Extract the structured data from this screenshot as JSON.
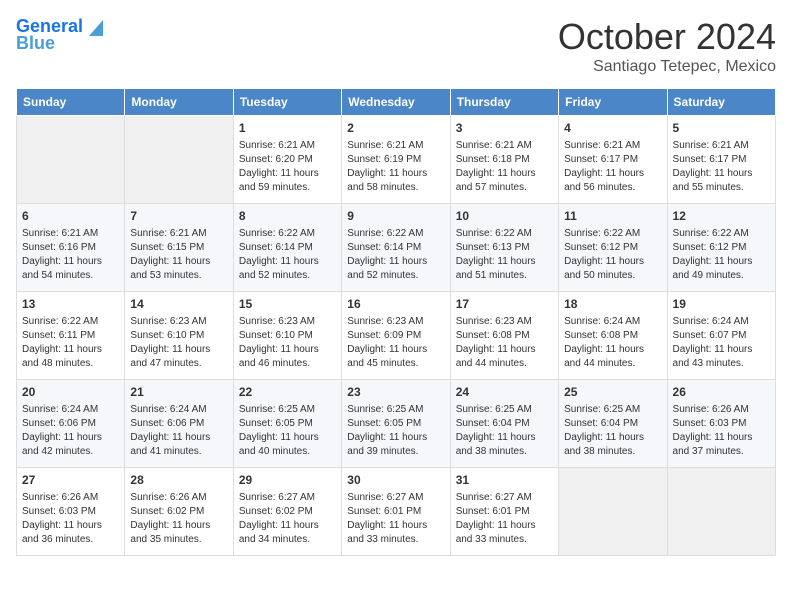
{
  "header": {
    "logo_line1": "General",
    "logo_line2": "Blue",
    "month": "October 2024",
    "location": "Santiago Tetepec, Mexico"
  },
  "weekdays": [
    "Sunday",
    "Monday",
    "Tuesday",
    "Wednesday",
    "Thursday",
    "Friday",
    "Saturday"
  ],
  "weeks": [
    [
      {
        "day": "",
        "sunrise": "",
        "sunset": "",
        "daylight": "",
        "empty": true
      },
      {
        "day": "",
        "sunrise": "",
        "sunset": "",
        "daylight": "",
        "empty": true
      },
      {
        "day": "1",
        "sunrise": "Sunrise: 6:21 AM",
        "sunset": "Sunset: 6:20 PM",
        "daylight": "Daylight: 11 hours and 59 minutes."
      },
      {
        "day": "2",
        "sunrise": "Sunrise: 6:21 AM",
        "sunset": "Sunset: 6:19 PM",
        "daylight": "Daylight: 11 hours and 58 minutes."
      },
      {
        "day": "3",
        "sunrise": "Sunrise: 6:21 AM",
        "sunset": "Sunset: 6:18 PM",
        "daylight": "Daylight: 11 hours and 57 minutes."
      },
      {
        "day": "4",
        "sunrise": "Sunrise: 6:21 AM",
        "sunset": "Sunset: 6:17 PM",
        "daylight": "Daylight: 11 hours and 56 minutes."
      },
      {
        "day": "5",
        "sunrise": "Sunrise: 6:21 AM",
        "sunset": "Sunset: 6:17 PM",
        "daylight": "Daylight: 11 hours and 55 minutes."
      }
    ],
    [
      {
        "day": "6",
        "sunrise": "Sunrise: 6:21 AM",
        "sunset": "Sunset: 6:16 PM",
        "daylight": "Daylight: 11 hours and 54 minutes."
      },
      {
        "day": "7",
        "sunrise": "Sunrise: 6:21 AM",
        "sunset": "Sunset: 6:15 PM",
        "daylight": "Daylight: 11 hours and 53 minutes."
      },
      {
        "day": "8",
        "sunrise": "Sunrise: 6:22 AM",
        "sunset": "Sunset: 6:14 PM",
        "daylight": "Daylight: 11 hours and 52 minutes."
      },
      {
        "day": "9",
        "sunrise": "Sunrise: 6:22 AM",
        "sunset": "Sunset: 6:14 PM",
        "daylight": "Daylight: 11 hours and 52 minutes."
      },
      {
        "day": "10",
        "sunrise": "Sunrise: 6:22 AM",
        "sunset": "Sunset: 6:13 PM",
        "daylight": "Daylight: 11 hours and 51 minutes."
      },
      {
        "day": "11",
        "sunrise": "Sunrise: 6:22 AM",
        "sunset": "Sunset: 6:12 PM",
        "daylight": "Daylight: 11 hours and 50 minutes."
      },
      {
        "day": "12",
        "sunrise": "Sunrise: 6:22 AM",
        "sunset": "Sunset: 6:12 PM",
        "daylight": "Daylight: 11 hours and 49 minutes."
      }
    ],
    [
      {
        "day": "13",
        "sunrise": "Sunrise: 6:22 AM",
        "sunset": "Sunset: 6:11 PM",
        "daylight": "Daylight: 11 hours and 48 minutes."
      },
      {
        "day": "14",
        "sunrise": "Sunrise: 6:23 AM",
        "sunset": "Sunset: 6:10 PM",
        "daylight": "Daylight: 11 hours and 47 minutes."
      },
      {
        "day": "15",
        "sunrise": "Sunrise: 6:23 AM",
        "sunset": "Sunset: 6:10 PM",
        "daylight": "Daylight: 11 hours and 46 minutes."
      },
      {
        "day": "16",
        "sunrise": "Sunrise: 6:23 AM",
        "sunset": "Sunset: 6:09 PM",
        "daylight": "Daylight: 11 hours and 45 minutes."
      },
      {
        "day": "17",
        "sunrise": "Sunrise: 6:23 AM",
        "sunset": "Sunset: 6:08 PM",
        "daylight": "Daylight: 11 hours and 44 minutes."
      },
      {
        "day": "18",
        "sunrise": "Sunrise: 6:24 AM",
        "sunset": "Sunset: 6:08 PM",
        "daylight": "Daylight: 11 hours and 44 minutes."
      },
      {
        "day": "19",
        "sunrise": "Sunrise: 6:24 AM",
        "sunset": "Sunset: 6:07 PM",
        "daylight": "Daylight: 11 hours and 43 minutes."
      }
    ],
    [
      {
        "day": "20",
        "sunrise": "Sunrise: 6:24 AM",
        "sunset": "Sunset: 6:06 PM",
        "daylight": "Daylight: 11 hours and 42 minutes."
      },
      {
        "day": "21",
        "sunrise": "Sunrise: 6:24 AM",
        "sunset": "Sunset: 6:06 PM",
        "daylight": "Daylight: 11 hours and 41 minutes."
      },
      {
        "day": "22",
        "sunrise": "Sunrise: 6:25 AM",
        "sunset": "Sunset: 6:05 PM",
        "daylight": "Daylight: 11 hours and 40 minutes."
      },
      {
        "day": "23",
        "sunrise": "Sunrise: 6:25 AM",
        "sunset": "Sunset: 6:05 PM",
        "daylight": "Daylight: 11 hours and 39 minutes."
      },
      {
        "day": "24",
        "sunrise": "Sunrise: 6:25 AM",
        "sunset": "Sunset: 6:04 PM",
        "daylight": "Daylight: 11 hours and 38 minutes."
      },
      {
        "day": "25",
        "sunrise": "Sunrise: 6:25 AM",
        "sunset": "Sunset: 6:04 PM",
        "daylight": "Daylight: 11 hours and 38 minutes."
      },
      {
        "day": "26",
        "sunrise": "Sunrise: 6:26 AM",
        "sunset": "Sunset: 6:03 PM",
        "daylight": "Daylight: 11 hours and 37 minutes."
      }
    ],
    [
      {
        "day": "27",
        "sunrise": "Sunrise: 6:26 AM",
        "sunset": "Sunset: 6:03 PM",
        "daylight": "Daylight: 11 hours and 36 minutes."
      },
      {
        "day": "28",
        "sunrise": "Sunrise: 6:26 AM",
        "sunset": "Sunset: 6:02 PM",
        "daylight": "Daylight: 11 hours and 35 minutes."
      },
      {
        "day": "29",
        "sunrise": "Sunrise: 6:27 AM",
        "sunset": "Sunset: 6:02 PM",
        "daylight": "Daylight: 11 hours and 34 minutes."
      },
      {
        "day": "30",
        "sunrise": "Sunrise: 6:27 AM",
        "sunset": "Sunset: 6:01 PM",
        "daylight": "Daylight: 11 hours and 33 minutes."
      },
      {
        "day": "31",
        "sunrise": "Sunrise: 6:27 AM",
        "sunset": "Sunset: 6:01 PM",
        "daylight": "Daylight: 11 hours and 33 minutes."
      },
      {
        "day": "",
        "sunrise": "",
        "sunset": "",
        "daylight": "",
        "empty": true
      },
      {
        "day": "",
        "sunrise": "",
        "sunset": "",
        "daylight": "",
        "empty": true
      }
    ]
  ]
}
